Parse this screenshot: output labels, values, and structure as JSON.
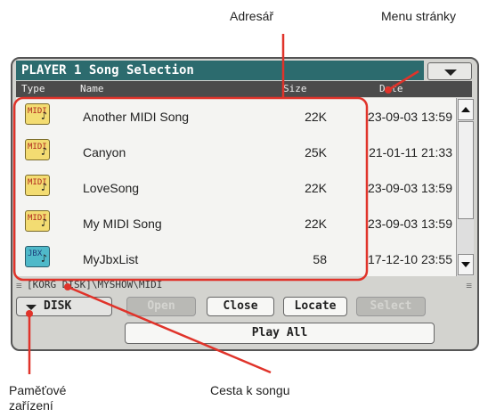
{
  "annotations": {
    "directory": "Adresář",
    "page_menu": "Menu stránky",
    "storage_device": [
      "Paměťové",
      "zařízení"
    ],
    "song_path": "Cesta k songu"
  },
  "window": {
    "title": "PLAYER 1 Song Selection"
  },
  "columns": {
    "type": "Type",
    "name": "Name",
    "size": "Size",
    "date": "Date"
  },
  "files": [
    {
      "type": "MIDI",
      "name": "Another MIDI Song",
      "size": "22K",
      "date": "23-09-03 13:59"
    },
    {
      "type": "MIDI",
      "name": "Canyon",
      "size": "25K",
      "date": "21-01-11 21:33"
    },
    {
      "type": "MIDI",
      "name": "LoveSong",
      "size": "22K",
      "date": "23-09-03 13:59"
    },
    {
      "type": "MIDI",
      "name": "My MIDI Song",
      "size": "22K",
      "date": "23-09-03 13:59"
    },
    {
      "type": "JBX",
      "name": "MyJbxList",
      "size": "58",
      "date": "17-12-10 23:55"
    }
  ],
  "path": "[KORG DISK]\\MYSHOW\\MIDI",
  "buttons": {
    "device": "DISK",
    "open": "Open",
    "close": "Close",
    "locate": "Locate",
    "select": "Select",
    "play_all": "Play All"
  },
  "colors": {
    "title_bar": "#2c6b6e",
    "annotation_red": "#e0332a",
    "midi_icon": "#f3dc72",
    "jbx_icon": "#4fb9c9"
  }
}
